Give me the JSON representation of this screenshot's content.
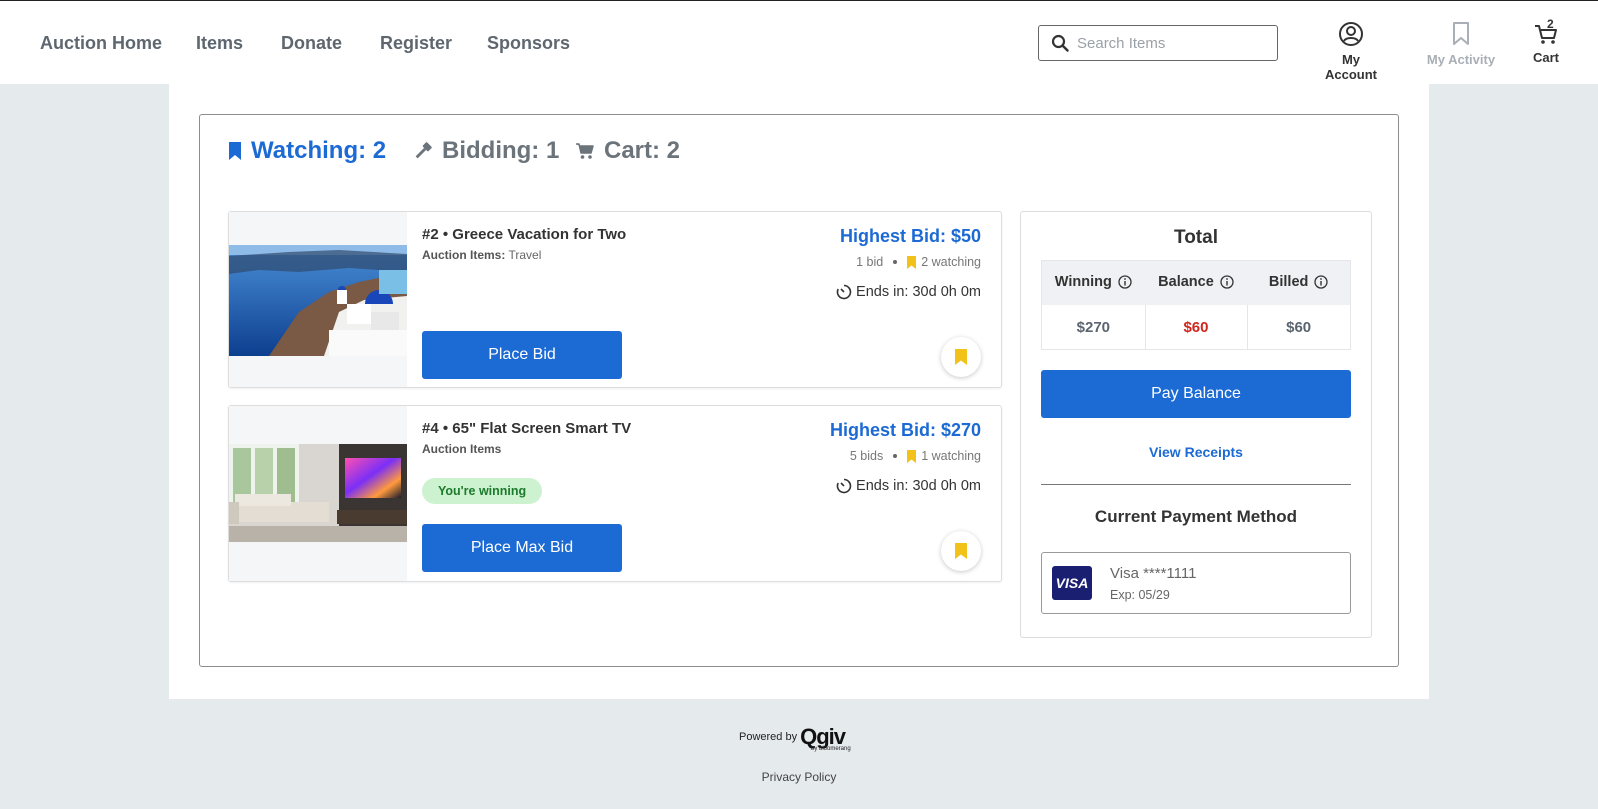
{
  "nav": {
    "items": [
      "Auction Home",
      "Items",
      "Donate",
      "Register",
      "Sponsors"
    ],
    "search_placeholder": "Search Items",
    "account_label": "My Account",
    "activity_label": "My Activity",
    "cart_label": "Cart",
    "cart_count": "2"
  },
  "tabs": {
    "watching": "Watching: 2",
    "bidding": "Bidding: 1",
    "cart": "Cart: 2"
  },
  "items": [
    {
      "title": "#2 • Greece Vacation for Two",
      "category_label": "Auction Items:",
      "category": "Travel",
      "highest_bid": "Highest Bid: $50",
      "bids": "1 bid",
      "watching": "2 watching",
      "ends": "Ends in: 30d 0h 0m",
      "button": "Place Bid",
      "image": "santorini-photo"
    },
    {
      "title": "#4 • 65\" Flat Screen Smart TV",
      "category_label": "Auction Items",
      "category": "",
      "status_badge": "You're winning",
      "highest_bid": "Highest Bid: $270",
      "bids": "5 bids",
      "watching": "1 watching",
      "ends": "Ends in: 30d 0h 0m",
      "button": "Place Max Bid",
      "image": "tv-living-room-photo"
    }
  ],
  "total": {
    "title": "Total",
    "headers": [
      "Winning",
      "Balance",
      "Billed"
    ],
    "values": [
      "$270",
      "$60",
      "$60"
    ],
    "pay_button": "Pay Balance",
    "receipts_link": "View Receipts",
    "payment_title": "Current Payment Method",
    "card_brand": "VISA",
    "card_number": "Visa ****1111",
    "card_exp": "Exp: 05/29"
  },
  "footer": {
    "powered_by": "Powered by",
    "logo": "Qgiv",
    "logo_sub": "by bloomerang",
    "privacy": "Privacy Policy"
  },
  "colors": {
    "primary": "#1c6ad3",
    "balance_red": "#d0261d",
    "bookmark_yellow": "#f2c21b",
    "winning_green_bg": "#cdf2cf"
  }
}
